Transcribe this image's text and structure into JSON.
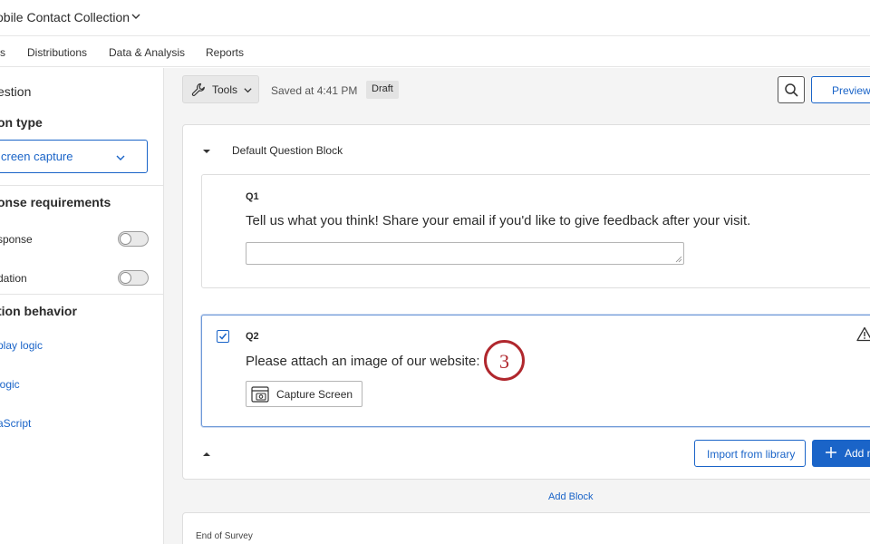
{
  "header": {
    "survey_title": "obile Contact Collection"
  },
  "nav": {
    "items": [
      {
        "label": "s"
      },
      {
        "label": "Distributions"
      },
      {
        "label": "Data & Analysis"
      },
      {
        "label": "Reports"
      }
    ]
  },
  "sidebar": {
    "title": "estion",
    "question_type_heading": "on type",
    "question_type_value": "creen capture",
    "response_req_heading": "onse requirements",
    "force_response_label": "sponse",
    "validation_label": "dation",
    "behavior_heading": "tion behavior",
    "links": [
      {
        "label": "play logic"
      },
      {
        "label": " logic"
      },
      {
        "label": "aScript"
      }
    ]
  },
  "toolbar": {
    "tools_label": "Tools",
    "saved_text": "Saved at 4:41 PM",
    "draft_badge": "Draft",
    "preview_label": "Preview"
  },
  "block": {
    "title": "Default Question Block",
    "questions": [
      {
        "number": "Q1",
        "text": "Tell us what you think! Share your email if you'd like to give feedback after your visit."
      },
      {
        "number": "Q2",
        "text": "Please attach an image of our website:",
        "capture_button": "Capture Screen"
      }
    ],
    "import_button": "Import from library",
    "add_new_button": "Add n"
  },
  "step_badge": "3",
  "add_block_label": "Add Block",
  "end_of_survey_label": "End of Survey",
  "colors": {
    "accent": "#1a64c8",
    "step_badge": "#b0272d",
    "background": "#f4f4f4"
  }
}
